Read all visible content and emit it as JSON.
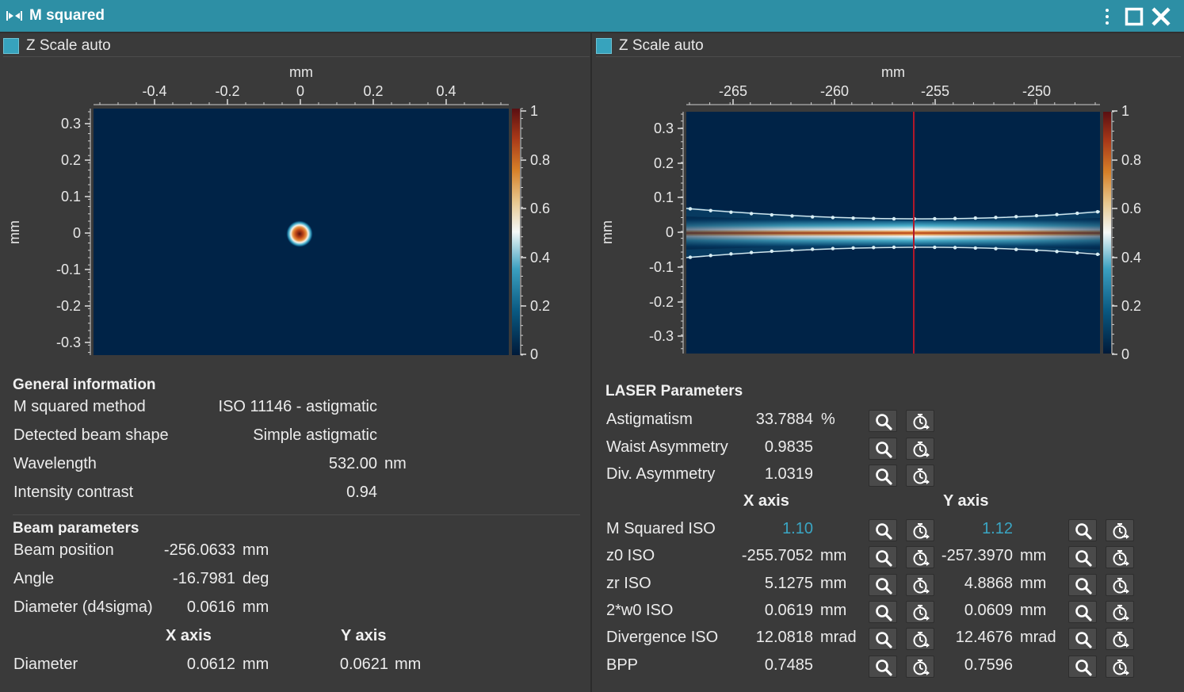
{
  "window": {
    "title": "M squared"
  },
  "left_plot": {
    "z_scale_label": "Z Scale auto",
    "x_unit": "mm",
    "y_unit": "mm",
    "x_ticks": [
      "-0.4",
      "-0.2",
      "0",
      "0.2",
      "0.4"
    ],
    "y_ticks": [
      "0.3",
      "0.2",
      "0.1",
      "0",
      "-0.1",
      "-0.2",
      "-0.3"
    ],
    "colorbar_ticks": [
      "1",
      "0.8",
      "0.6",
      "0.4",
      "0.2",
      "0"
    ]
  },
  "right_plot": {
    "z_scale_label": "Z Scale auto",
    "x_unit": "mm",
    "y_unit": "mm",
    "x_ticks": [
      "-265",
      "-260",
      "-255",
      "-250"
    ],
    "y_ticks": [
      "0.3",
      "0.2",
      "0.1",
      "0",
      "-0.1",
      "-0.2",
      "-0.3"
    ],
    "colorbar_ticks": [
      "1",
      "0.8",
      "0.6",
      "0.4",
      "0.2",
      "0"
    ]
  },
  "general_information": {
    "title": "General information",
    "rows": [
      {
        "label": "M squared method",
        "value": "ISO 11146 - astigmatic",
        "unit": ""
      },
      {
        "label": "Detected beam shape",
        "value": "Simple astigmatic",
        "unit": ""
      },
      {
        "label": "Wavelength",
        "value": "532.00",
        "unit": "nm"
      },
      {
        "label": "Intensity contrast",
        "value": "0.94",
        "unit": ""
      }
    ]
  },
  "beam_parameters": {
    "title": "Beam parameters",
    "rows": [
      {
        "label": "Beam position",
        "value": "-256.0633",
        "unit": "mm"
      },
      {
        "label": "Angle",
        "value": "-16.7981",
        "unit": "deg"
      },
      {
        "label": "Diameter (d4sigma)",
        "value": "0.0616",
        "unit": "mm"
      }
    ],
    "x_axis_header": "X axis",
    "y_axis_header": "Y axis",
    "diameter": {
      "label": "Diameter",
      "x_value": "0.0612",
      "x_unit": "mm",
      "y_value": "0.0621",
      "y_unit": "mm"
    }
  },
  "laser_parameters": {
    "title": "LASER Parameters",
    "single_rows": [
      {
        "label": "Astigmatism",
        "value": "33.7884",
        "unit": "%"
      },
      {
        "label": "Waist Asymmetry",
        "value": "0.9835",
        "unit": ""
      },
      {
        "label": "Div. Asymmetry",
        "value": "1.0319",
        "unit": ""
      }
    ],
    "x_axis_header": "X axis",
    "y_axis_header": "Y axis",
    "axis_rows": [
      {
        "label": "M Squared ISO",
        "x_value": "1.10",
        "x_unit": "",
        "y_value": "1.12",
        "y_unit": ""
      },
      {
        "label": "z0 ISO",
        "x_value": "-255.7052",
        "x_unit": "mm",
        "y_value": "-257.3970",
        "y_unit": "mm"
      },
      {
        "label": "zr ISO",
        "x_value": "5.1275",
        "x_unit": "mm",
        "y_value": "4.8868",
        "y_unit": "mm"
      },
      {
        "label": "2*w0 ISO",
        "x_value": "0.0619",
        "x_unit": "mm",
        "y_value": "0.0609",
        "y_unit": "mm"
      },
      {
        "label": "Divergence ISO",
        "x_value": "12.0818",
        "x_unit": "mrad",
        "y_value": "12.4676",
        "y_unit": "mrad"
      },
      {
        "label": "BPP",
        "x_value": "0.7485",
        "x_unit": "",
        "y_value": "0.7596",
        "y_unit": ""
      }
    ]
  },
  "icons": {
    "zoom": "magnifier-icon",
    "stopwatch": "stopwatch-arrow-icon"
  },
  "colors": {
    "titlebar": "#2d8fa5",
    "panel_bg": "#3a3a3a",
    "plot_bg": "#002347",
    "accent_value": "#3aa6c4",
    "waist_line": "#b0182a"
  }
}
